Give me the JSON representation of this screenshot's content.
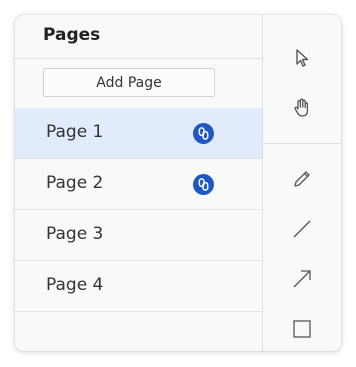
{
  "pages_panel": {
    "title": "Pages",
    "add_page_label": "Add Page",
    "pages": [
      {
        "label": "Page 1",
        "selected": true,
        "has_link_badge": true
      },
      {
        "label": "Page 2",
        "selected": false,
        "has_link_badge": true
      },
      {
        "label": "Page 3",
        "selected": false,
        "has_link_badge": false
      },
      {
        "label": "Page 4",
        "selected": false,
        "has_link_badge": false
      }
    ],
    "link_badge_icon": "link-icon"
  },
  "toolbar": {
    "tools": [
      {
        "icon": "pointer-icon"
      },
      {
        "icon": "hand-icon"
      },
      {
        "icon": "pencil-icon"
      },
      {
        "icon": "line-icon"
      },
      {
        "icon": "arrow-icon"
      },
      {
        "icon": "rectangle-icon"
      }
    ]
  },
  "colors": {
    "selected_row": "#e2ebfc",
    "badge": "#1f58c4",
    "panel_bg": "#f8f9f9"
  }
}
